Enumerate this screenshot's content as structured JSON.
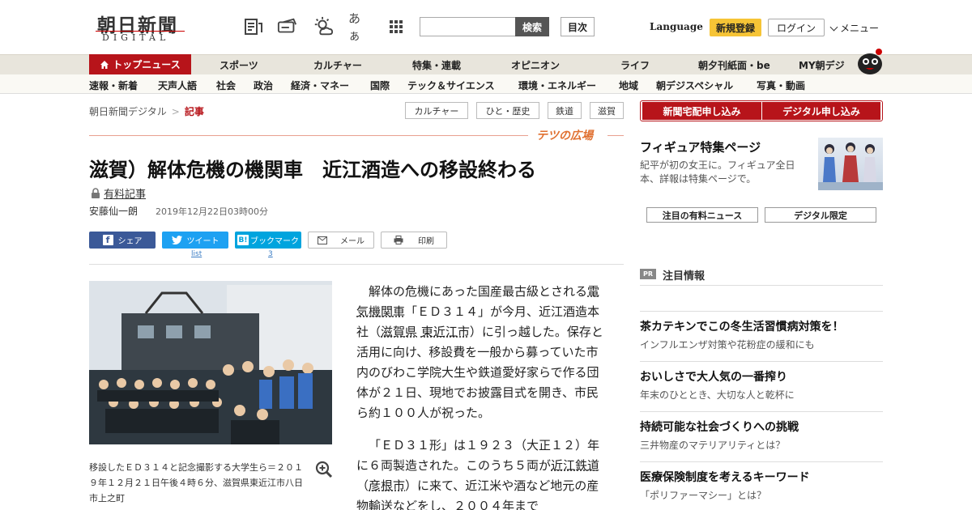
{
  "header": {
    "logo_main": "朝日新聞",
    "logo_sub": "DIGITAL",
    "search_button": "検索",
    "toc_button": "目次",
    "language": "Language",
    "register": "新規登録",
    "login": "ログイン",
    "menu": "メニュー",
    "font_size_label": "あぁ"
  },
  "nav_primary": {
    "active": "トップニュース",
    "items": [
      "スポーツ",
      "カルチャー",
      "特集・連載",
      "オピニオン",
      "ライフ",
      "朝夕刊紙面・be",
      "MY朝デジ"
    ]
  },
  "nav_secondary": {
    "items": [
      "速報・新着",
      "天声人語",
      "社会",
      "政治",
      "経済・マネー",
      "国際",
      "テック＆サイエンス",
      "環境・エネルギー",
      "地域",
      "朝デジスペシャル",
      "写真・動画"
    ]
  },
  "breadcrumb": {
    "home": "朝日新聞デジタル",
    "separator": ">",
    "current": "記事"
  },
  "tags": [
    "カルチャー",
    "ひと・歴史",
    "鉄道",
    "滋賀"
  ],
  "series_label": "テツの広場",
  "article": {
    "title": "滋賀）解体危機の機関車　近江酒造への移設終わる",
    "paid_label": "有料記事",
    "author": "安藤仙一朗",
    "date": "2019年12月22日03時00分",
    "share": {
      "facebook": "シェア",
      "twitter": "ツイート",
      "twitter_count": "list",
      "hatena": "ブックマーク",
      "hatena_count": "3",
      "mail": "メール",
      "print": "印刷"
    },
    "photo_caption": "移設したＥＤ３１４と記念撮影する大学生ら＝２０１９年１２月２１日午後４時６分、滋賀県東近江市八日市上之町",
    "paragraph1": {
      "a": "解体の危機にあった国産最古級とされる",
      "link1": "電気機関車",
      "b": "「ＥＤ３１４」が今月、近江酒造本社（",
      "link2": "滋賀県",
      "c": " ",
      "link3": "東近江市",
      "d": "）に引っ越した。保存と活用に向け、移設費を一般から募っていた市内のびわこ学院大生や鉄道愛好家らで作る団体が２１日、現地でお披露目式を開き、市民ら約１００人が祝った。"
    },
    "paragraph2": {
      "a": "「ＥＤ３１形」は１９２３（大正１２）年に６両製造された。このうち５両が",
      "link1": "近江鉄道",
      "b": "（",
      "link2": "彦根市",
      "c": "）に来て、近江米や酒など地元の産物輸送などをし、２００４年まで"
    }
  },
  "sidebar": {
    "subscribe_paper": "新聞宅配申し込み",
    "subscribe_digital": "デジタル申し込み",
    "feature_title": "フィギュア特集ページ",
    "feature_desc": "紀平が初の女王に。フィギュア全日本、詳報は特集ページで。",
    "btn_paid_news": "注目の有料ニュース",
    "btn_digital_only": "デジタル限定",
    "pr_badge": "PR",
    "pr_title": "注目情報",
    "pr_items": [
      {
        "head": "茶カテキンでこの冬生活習慣病対策を！",
        "sub": "インフルエンザ対策や花粉症の緩和にも"
      },
      {
        "head": "おいしさで大人気の一番搾り",
        "sub": "年末のひととき、大切な人と乾杯に"
      },
      {
        "head": "持続可能な社会づくりへの挑戦",
        "sub": "三井物産のマテリアリティとは？"
      },
      {
        "head": "医療保険制度を考えるキーワード",
        "sub": "「ポリファーマシー」とは？"
      }
    ]
  },
  "colors": {
    "brand_red": "#b7141a",
    "register_yellow": "#f6c436",
    "facebook": "#3b5998",
    "twitter": "#1da1f2",
    "hatena": "#00a4de"
  }
}
